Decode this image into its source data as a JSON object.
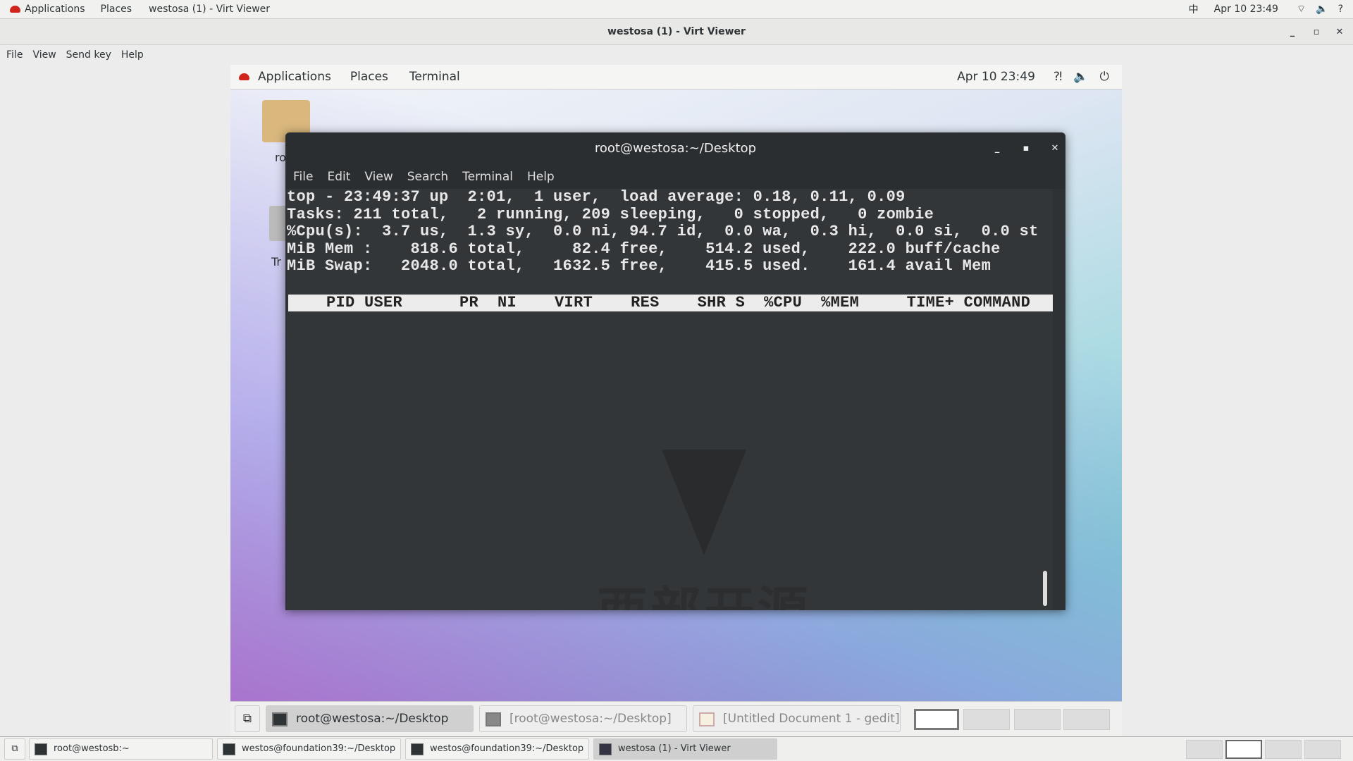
{
  "host_topbar": {
    "applications": "Applications",
    "places": "Places",
    "window": "westosa (1) - Virt Viewer",
    "input": "中",
    "datetime": "Apr 10  23:49"
  },
  "viewer": {
    "title": "westosa (1) - Virt Viewer",
    "menu": [
      "File",
      "View",
      "Send key",
      "Help"
    ]
  },
  "guest_topbar": {
    "applications": "Applications",
    "places": "Places",
    "terminal": "Terminal",
    "datetime": "Apr 10  23:49"
  },
  "desktop_icons": [
    "ro",
    "Tr"
  ],
  "terminal": {
    "title": "root@westosa:~/Desktop",
    "menu": [
      "File",
      "Edit",
      "View",
      "Search",
      "Terminal",
      "Help"
    ],
    "lines": [
      "top - 23:49:37 up  2:01,  1 user,  load average: 0.18, 0.11, 0.09",
      "Tasks: 211 total,   2 running, 209 sleeping,   0 stopped,   0 zombie",
      "%Cpu(s):  3.7 us,  1.3 sy,  0.0 ni, 94.7 id,  0.0 wa,  0.3 hi,  0.0 si,  0.0 st",
      "MiB Mem :    818.6 total,     82.4 free,    514.2 used,    222.0 buff/cache",
      "MiB Swap:   2048.0 total,   1632.5 free,    415.5 used.    161.4 avail Mem"
    ],
    "header": "    PID USER      PR  NI    VIRT    RES    SHR S  %CPU  %MEM     TIME+ COMMAND",
    "watermark": "西部开源"
  },
  "guest_taskbar": [
    "root@westosa:~/Desktop",
    "[root@westosa:~/Desktop]",
    "[Untitled Document 1 - gedit]"
  ],
  "host_taskbar": [
    "root@westosb:~",
    "westos@foundation39:~/Desktop",
    "westos@foundation39:~/Desktop",
    "westosa (1) - Virt Viewer"
  ]
}
